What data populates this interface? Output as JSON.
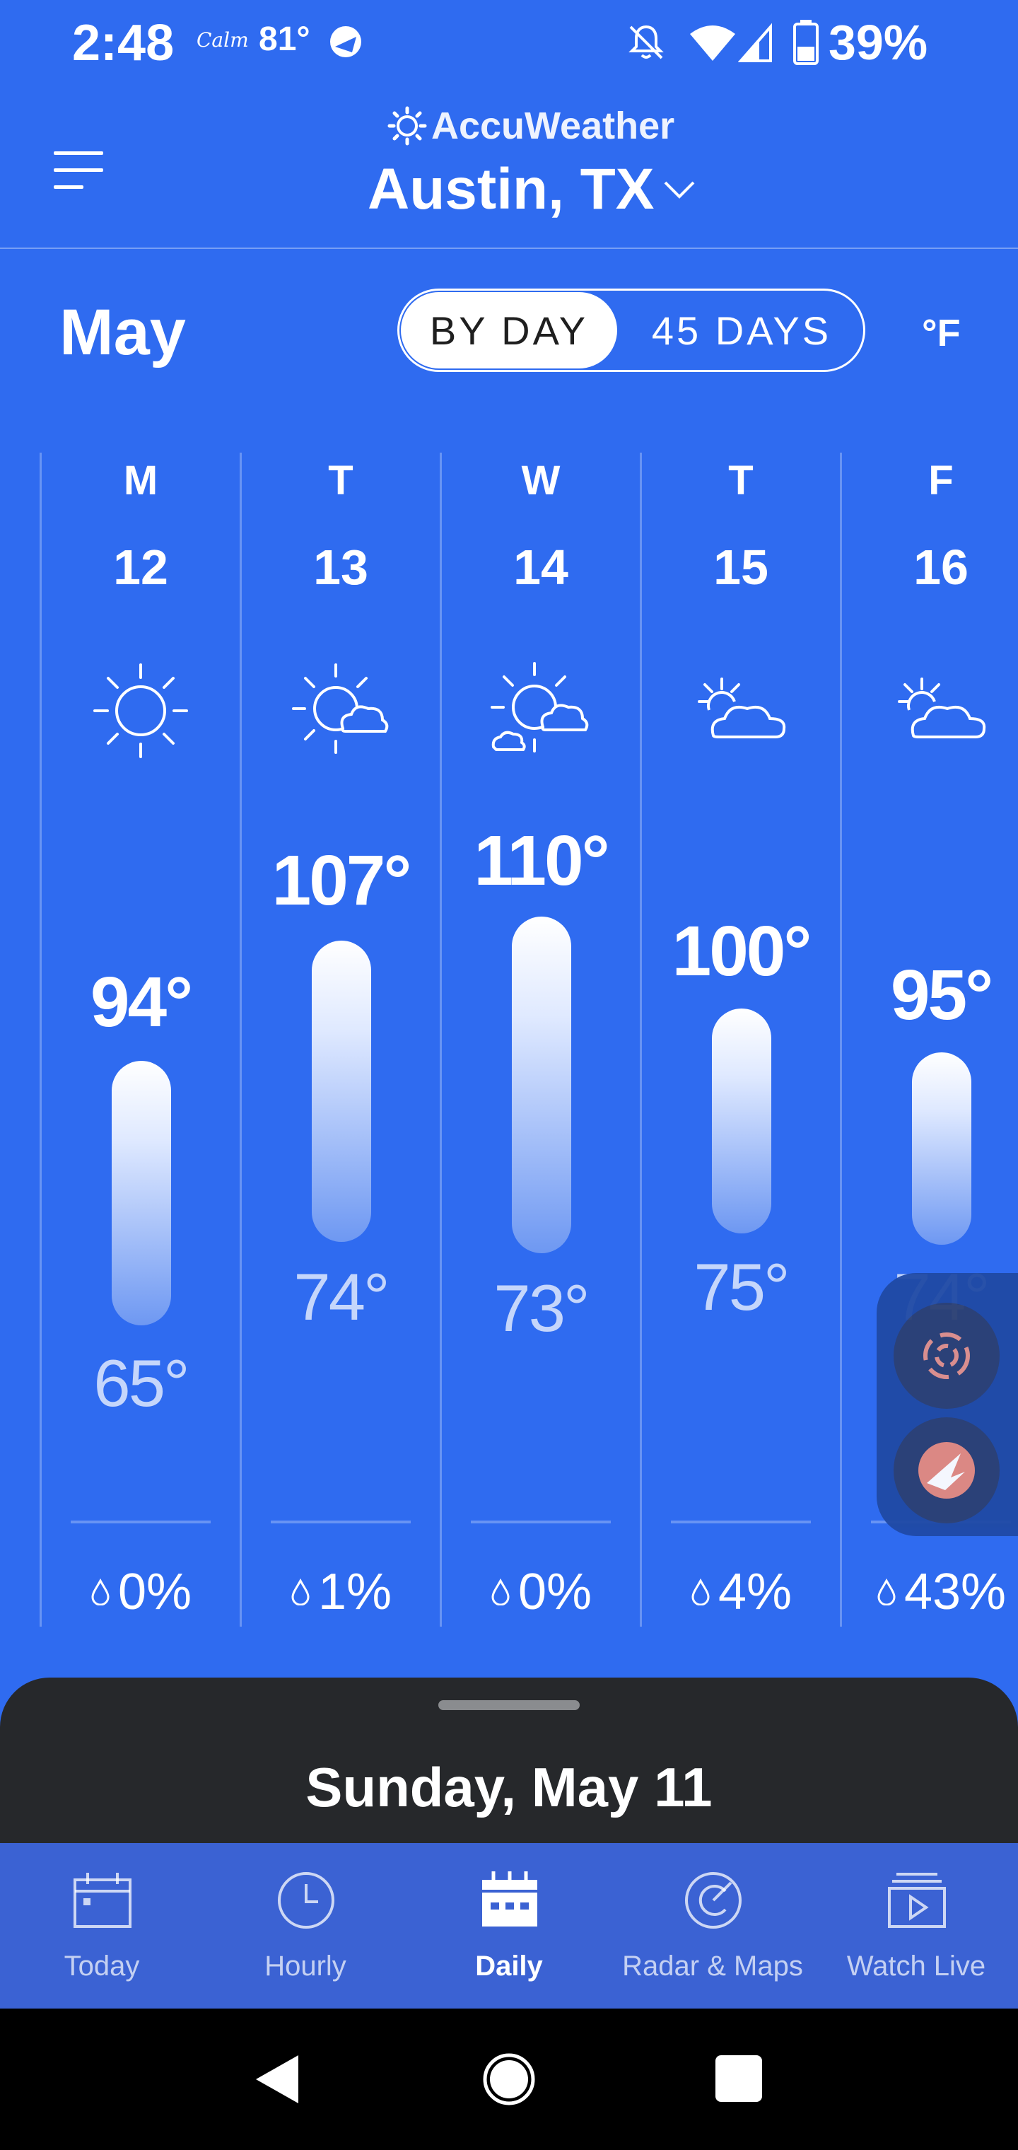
{
  "status_bar": {
    "time": "2:48",
    "weather_note": "Calm",
    "temperature": "81°",
    "battery": "39%",
    "icons": [
      "accuweather-notification-icon",
      "bell-off-icon",
      "wifi-icon",
      "signal-icon",
      "battery-icon"
    ]
  },
  "header": {
    "brand": "AccuWeather",
    "location": "Austin, TX",
    "icons": [
      "menu-icon",
      "sun-logo-icon",
      "chevron-down-icon"
    ]
  },
  "controls": {
    "month": "May",
    "toggle_options": [
      "BY DAY",
      "45 DAYS"
    ],
    "selected_toggle": "BY DAY",
    "unit": "°F"
  },
  "days": [
    {
      "dow": "M",
      "date": "12",
      "icon": "sunny-icon",
      "high": "94°",
      "low": "65°",
      "precip": "0%"
    },
    {
      "dow": "T",
      "date": "13",
      "icon": "mostly-sunny-icon",
      "high": "107°",
      "low": "74°",
      "precip": "1%"
    },
    {
      "dow": "W",
      "date": "14",
      "icon": "partly-sunny-icon",
      "high": "110°",
      "low": "73°",
      "precip": "0%"
    },
    {
      "dow": "T",
      "date": "15",
      "icon": "partly-cloudy-icon",
      "high": "100°",
      "low": "75°",
      "precip": "4%"
    },
    {
      "dow": "F",
      "date": "16",
      "icon": "partly-cloudy-icon",
      "high": "95°",
      "low": "74°",
      "precip": "43%"
    }
  ],
  "sheet": {
    "title": "Sunday, May 11"
  },
  "nav": {
    "items": [
      {
        "label": "Today",
        "icon": "calendar-today-icon"
      },
      {
        "label": "Hourly",
        "icon": "clock-icon"
      },
      {
        "label": "Daily",
        "icon": "calendar-daily-icon"
      },
      {
        "label": "Radar & Maps",
        "icon": "radar-icon"
      },
      {
        "label": "Watch Live",
        "icon": "play-video-icon"
      }
    ],
    "active": "Daily"
  },
  "floating_bubbles": [
    "assistant-bubble-icon",
    "chat-bubble-icon"
  ],
  "system_nav": [
    "back-icon",
    "home-icon",
    "recents-icon"
  ],
  "colors": {
    "background": "#2f6bf0",
    "sheet": "#26282b",
    "nav": "#3b62d3",
    "toggle_selected_bg": "#ffffff"
  }
}
